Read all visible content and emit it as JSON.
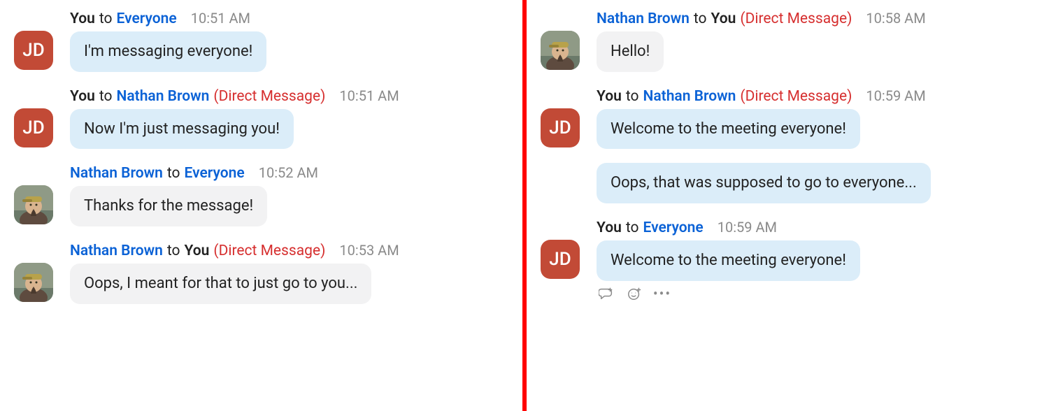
{
  "colors": {
    "jdAvatar": "#c24a36",
    "link": "#0b62d6",
    "dm": "#d62f2f",
    "bubbleBlue": "#dbedf9",
    "bubbleGray": "#f2f2f3",
    "divider": "#ff0000"
  },
  "left": {
    "groups": [
      {
        "avatar": {
          "type": "initials",
          "text": "JD"
        },
        "header": {
          "fromName": "You",
          "fromIsLink": false,
          "toName": "Everyone",
          "toIsLink": true,
          "dm": "",
          "time": "10:51 AM"
        },
        "bubbles": [
          {
            "style": "blue",
            "text": "I'm messaging everyone!"
          }
        ]
      },
      {
        "avatar": {
          "type": "initials",
          "text": "JD"
        },
        "header": {
          "fromName": "You",
          "fromIsLink": false,
          "toName": "Nathan Brown",
          "toIsLink": true,
          "dm": "(Direct Message)",
          "time": "10:51 AM"
        },
        "bubbles": [
          {
            "style": "blue",
            "text": "Now I'm just messaging you!"
          }
        ]
      },
      {
        "avatar": {
          "type": "photo"
        },
        "header": {
          "fromName": "Nathan Brown",
          "fromIsLink": true,
          "toName": "Everyone",
          "toIsLink": true,
          "dm": "",
          "time": "10:52 AM"
        },
        "bubbles": [
          {
            "style": "gray",
            "text": "Thanks for the message!"
          }
        ]
      },
      {
        "avatar": {
          "type": "photo"
        },
        "header": {
          "fromName": "Nathan Brown",
          "fromIsLink": true,
          "toName": "You",
          "toIsLink": false,
          "dm": "(Direct Message)",
          "time": "10:53 AM"
        },
        "bubbles": [
          {
            "style": "gray",
            "text": "Oops, I meant for that to just go to you..."
          }
        ]
      }
    ]
  },
  "right": {
    "groups": [
      {
        "avatar": {
          "type": "photo"
        },
        "header": {
          "fromName": "Nathan Brown",
          "fromIsLink": true,
          "toName": "You",
          "toIsLink": false,
          "dm": "(Direct Message)",
          "time": "10:58 AM"
        },
        "bubbles": [
          {
            "style": "gray",
            "text": "Hello!"
          }
        ]
      },
      {
        "avatar": {
          "type": "initials",
          "text": "JD"
        },
        "header": {
          "fromName": "You",
          "fromIsLink": false,
          "toName": "Nathan Brown",
          "toIsLink": true,
          "dm": "(Direct Message)",
          "time": "10:59 AM"
        },
        "bubbles": [
          {
            "style": "blue",
            "text": "Welcome to the meeting everyone!"
          },
          {
            "style": "blue",
            "text": "Oops, that was supposed to go to everyone..."
          }
        ]
      },
      {
        "avatar": {
          "type": "initials",
          "text": "JD"
        },
        "header": {
          "fromName": "You",
          "fromIsLink": false,
          "toName": "Everyone",
          "toIsLink": true,
          "dm": "",
          "time": "10:59 AM"
        },
        "bubbles": [
          {
            "style": "blue",
            "text": "Welcome to the meeting everyone!"
          }
        ],
        "actions": true
      }
    ]
  },
  "words": {
    "to": "to"
  }
}
